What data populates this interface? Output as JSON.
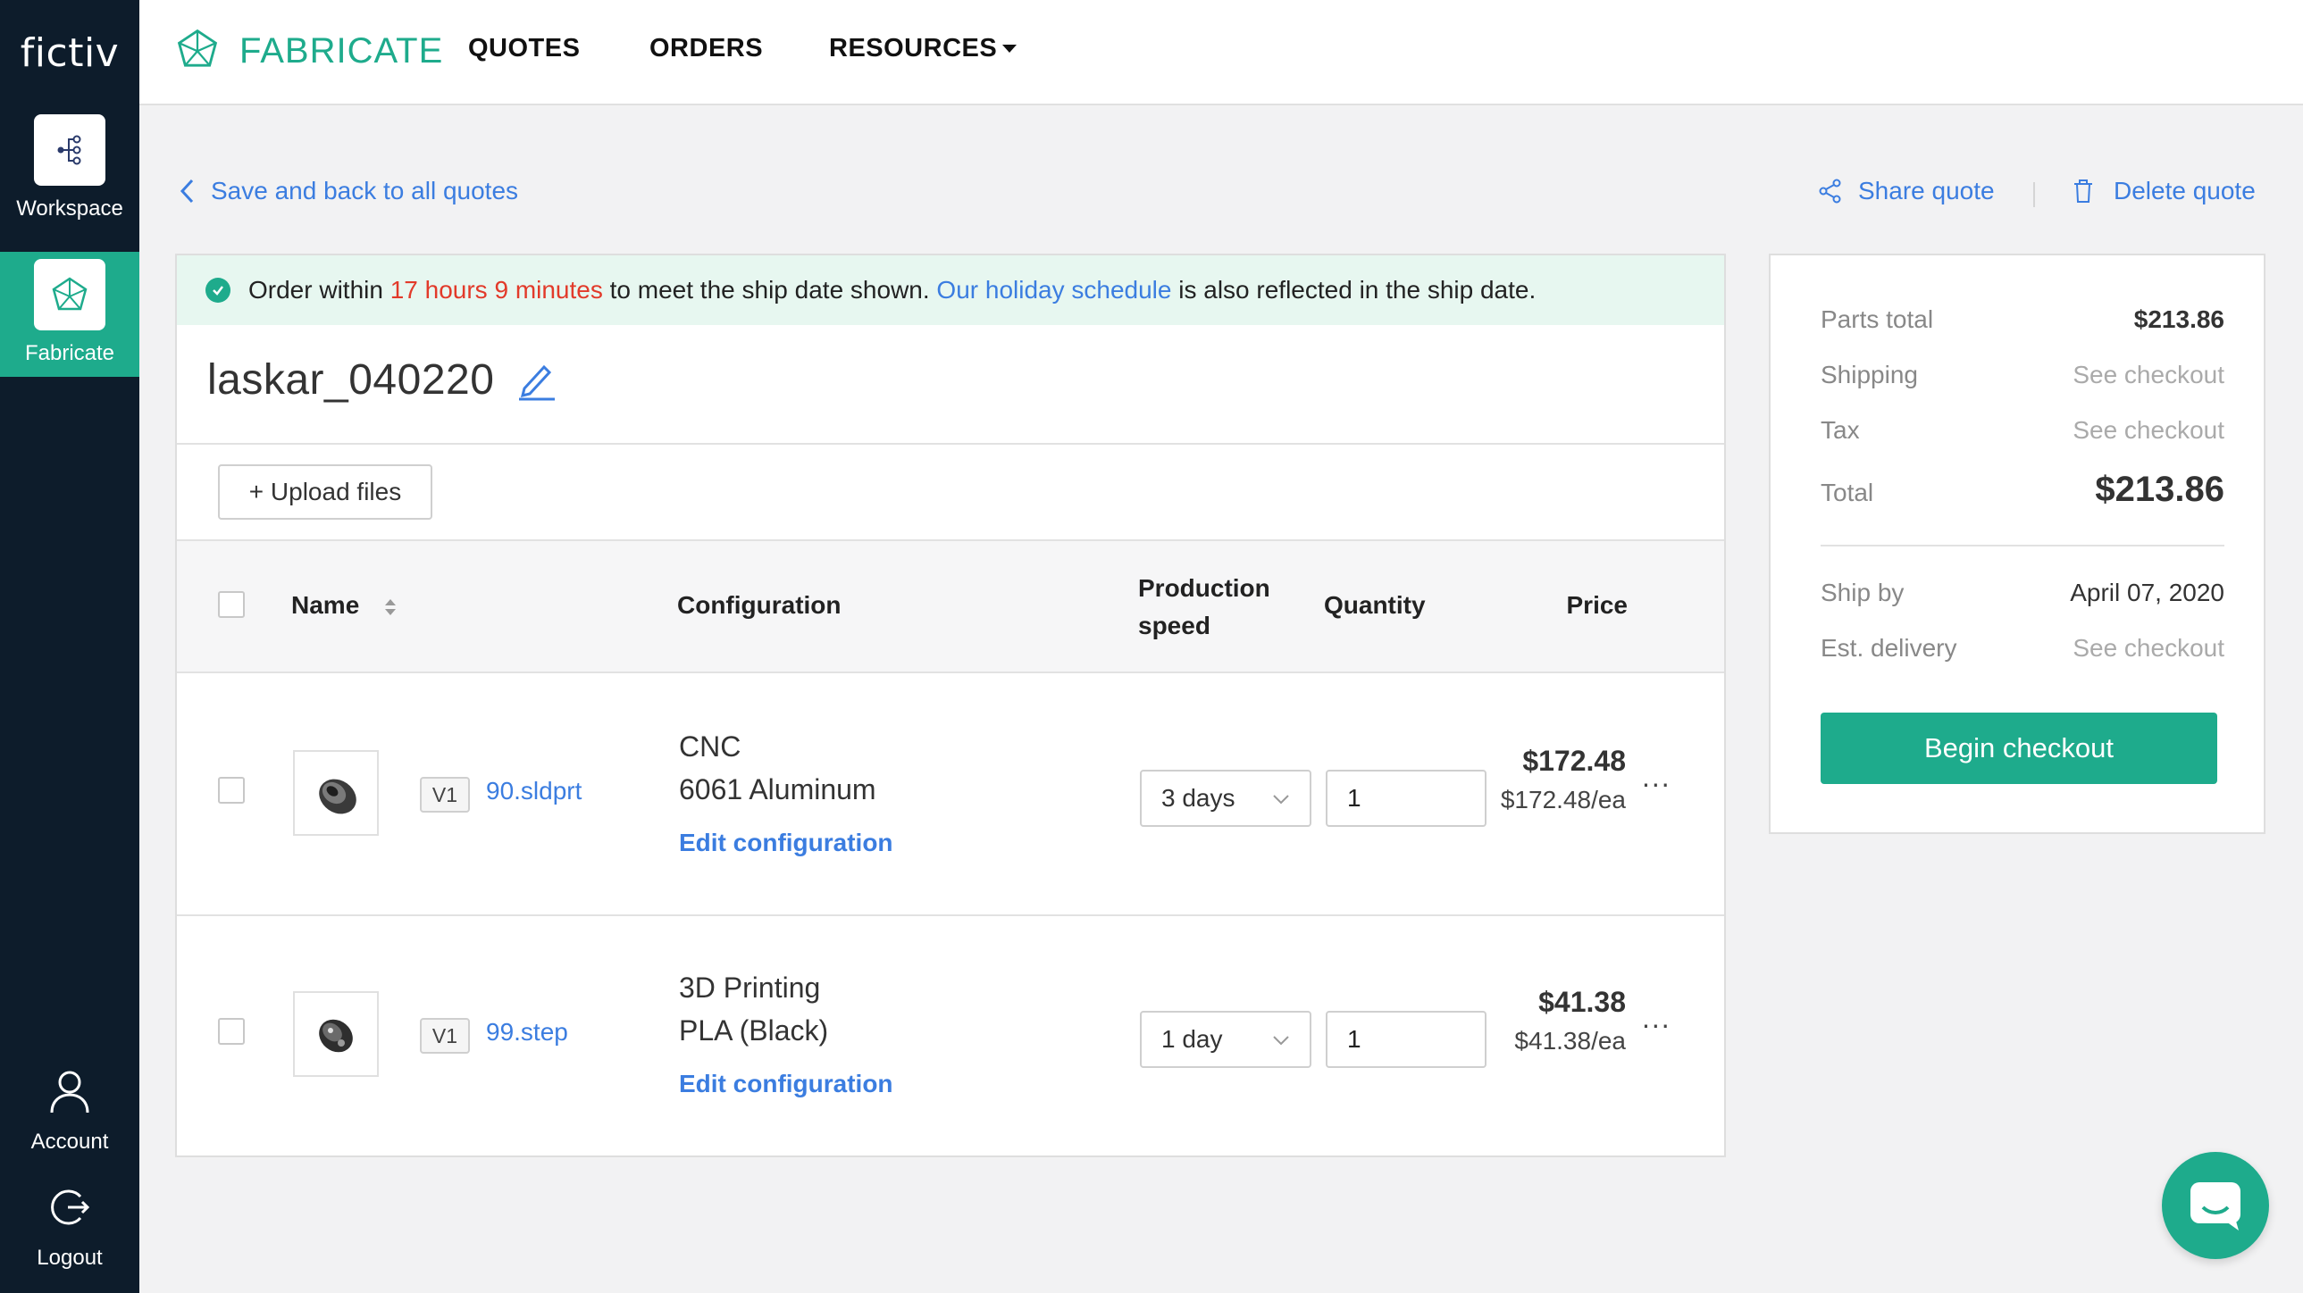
{
  "sidebar": {
    "logo": "fictiv",
    "items": [
      {
        "label": "Workspace",
        "icon": "workspace-icon"
      },
      {
        "label": "Fabricate",
        "icon": "fabricate-icon"
      },
      {
        "label": "Account",
        "icon": "account-icon"
      },
      {
        "label": "Logout",
        "icon": "logout-icon"
      }
    ]
  },
  "topbar": {
    "brand": "FABRICATE",
    "nav": {
      "quotes": "QUOTES",
      "orders": "ORDERS",
      "resources": "RESOURCES"
    }
  },
  "actions": {
    "back": "Save and back to all quotes",
    "share": "Share quote",
    "delete": "Delete quote"
  },
  "banner": {
    "prefix": "Order within",
    "countdown": "17 hours 9 minutes",
    "middle": "to meet the ship date shown.",
    "link": "Our holiday schedule",
    "suffix": "is also reflected in the ship date."
  },
  "quote": {
    "name": "laskar_040220",
    "upload_label": "+ Upload files"
  },
  "table": {
    "headers": {
      "name": "Name",
      "configuration": "Configuration",
      "speed_line1": "Production",
      "speed_line2": "speed",
      "quantity": "Quantity",
      "price": "Price"
    },
    "rows": [
      {
        "version": "V1",
        "file_base": "90",
        "file_ext": ".sldprt",
        "process": "CNC",
        "material": "6061 Aluminum",
        "edit_label": "Edit configuration",
        "speed": "3 days",
        "quantity": "1",
        "price": "$172.48",
        "price_each": "$172.48/ea",
        "more": "..."
      },
      {
        "version": "V1",
        "file_base": "99",
        "file_ext": ".step",
        "process": "3D Printing",
        "material": "PLA (Black)",
        "edit_label": "Edit configuration",
        "speed": "1 day",
        "quantity": "1",
        "price": "$41.38",
        "price_each": "$41.38/ea",
        "more": "..."
      }
    ]
  },
  "summary": {
    "parts_total_label": "Parts total",
    "parts_total": "$213.86",
    "shipping_label": "Shipping",
    "shipping": "See checkout",
    "tax_label": "Tax",
    "tax": "See checkout",
    "total_label": "Total",
    "total": "$213.86",
    "ship_by_label": "Ship by",
    "ship_by": "April 07, 2020",
    "delivery_label": "Est. delivery",
    "delivery": "See checkout",
    "checkout_label": "Begin checkout"
  },
  "colors": {
    "accent": "#1eab8c",
    "link": "#3b7de0",
    "sidebar": "#0d1c2b",
    "countdown": "#e23a2a",
    "banner_bg": "#e7f7f0"
  }
}
